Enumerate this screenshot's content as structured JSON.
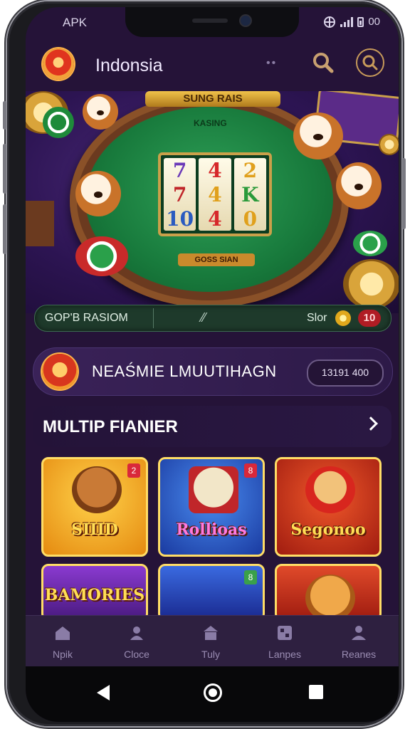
{
  "status_bar": {
    "carrier": "APK",
    "right_text": "00"
  },
  "app_bar": {
    "title": "Indonsia",
    "dots": "••"
  },
  "hero": {
    "top_banner": "SUNG RAIS",
    "felt_label": "KASING",
    "reels": [
      [
        "7",
        "7",
        "10"
      ],
      [
        "4",
        "4",
        "4"
      ],
      [
        "2",
        "K",
        "0"
      ]
    ],
    "felt_bottom": "GOSS SIAN",
    "bar_left": "GOP'B RASIOM",
    "bar_mid": "⁄⁄",
    "bar_right": "Slor",
    "bar_badge": "10"
  },
  "promo": {
    "title": "NEAŚMIE LMUUTIHAGN",
    "pill": "13191 400"
  },
  "section": {
    "title": "MULTIP FIANIER"
  },
  "tiles": [
    {
      "label": "SIIID",
      "tag": "2",
      "bg": "#f3a21f"
    },
    {
      "label": "Rollioas",
      "tag": "8",
      "bg": "#2f62c9"
    },
    {
      "label": "Segonoo",
      "tag": "",
      "bg": "#d63a1c"
    },
    {
      "label": "BAMORIES",
      "tag": "",
      "bg": "#6a2ca0"
    },
    {
      "label": "",
      "tag": "8",
      "bg": "#2848b0"
    },
    {
      "label": "",
      "tag": "",
      "bg": "#d8452a"
    }
  ],
  "tabs": [
    {
      "label": "Npik",
      "icon": "home-icon"
    },
    {
      "label": "Cloce",
      "icon": "user-slash-icon"
    },
    {
      "label": "Tuly",
      "icon": "store-icon"
    },
    {
      "label": "Lanpes",
      "icon": "grid-icon"
    },
    {
      "label": "Reanes",
      "icon": "person-icon"
    }
  ],
  "colors": {
    "background": "#251338",
    "accent_gold": "#caa04a",
    "badge_red": "#b01c24"
  }
}
